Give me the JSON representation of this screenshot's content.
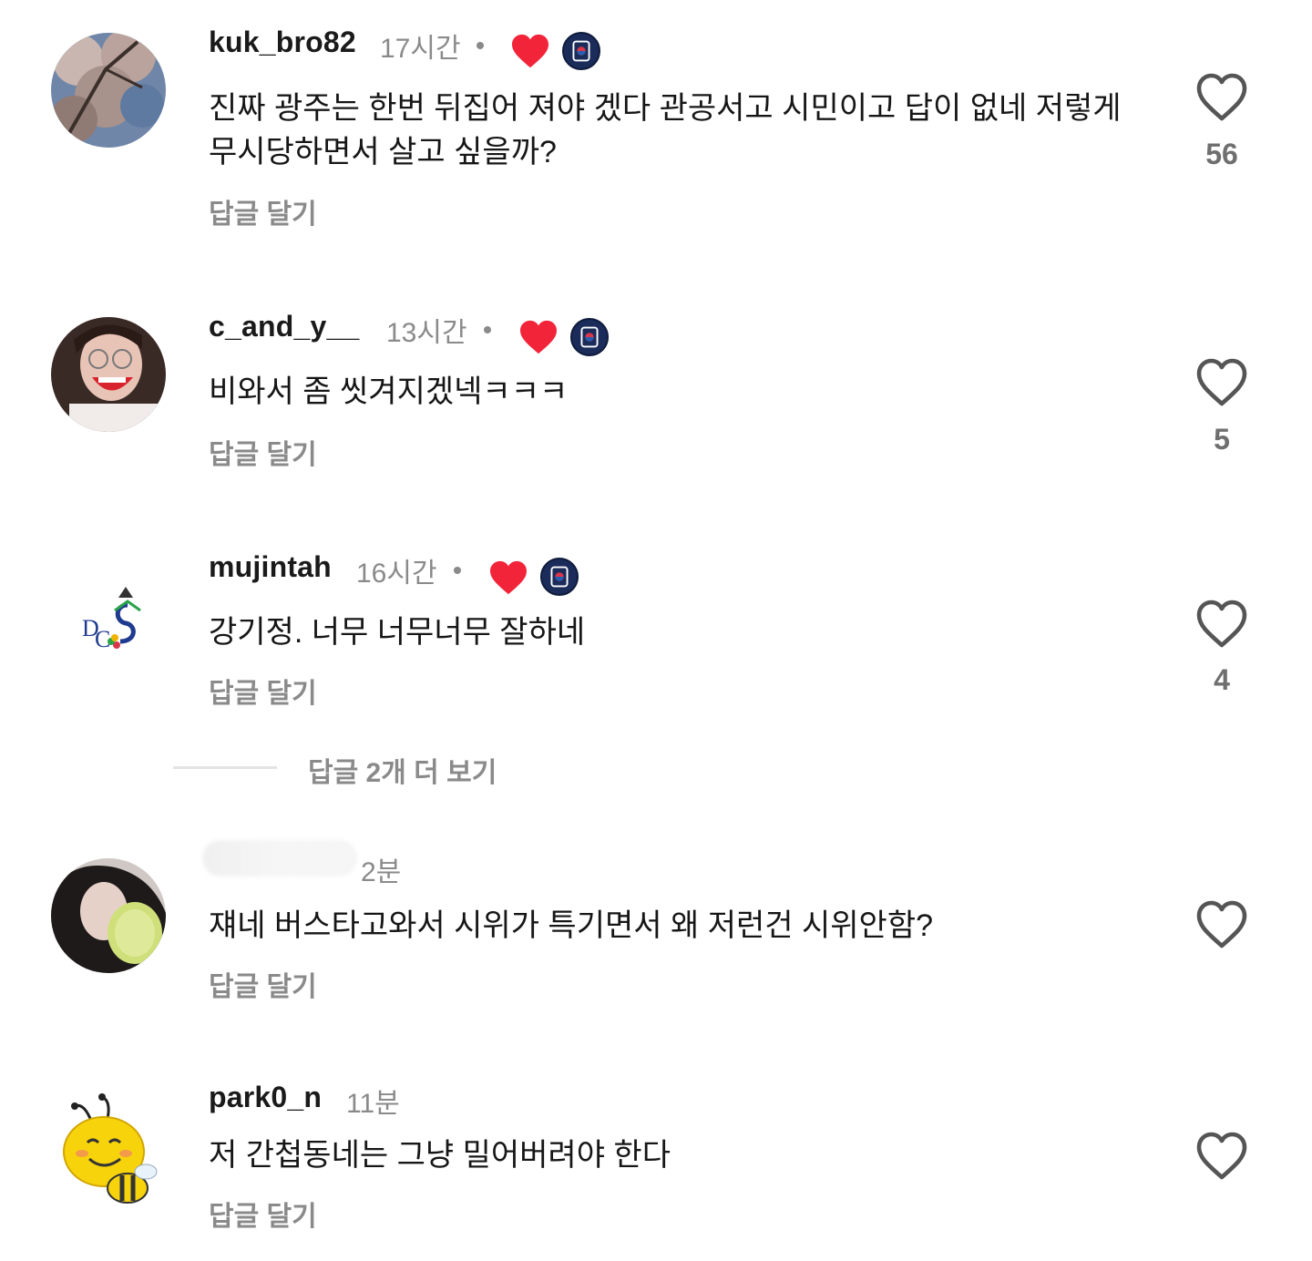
{
  "comments": [
    {
      "username": "kuk_bro82",
      "time": "17시간",
      "text": "진짜 광주는 한번 뒤집어 져야 겠다 관공서고 시민이고 답이 없네 저렇게 무시당하면서 살고 싶을까?",
      "reply_label": "답글 달기",
      "likes": "56",
      "creator_liked": true
    },
    {
      "username": "c_and_y__",
      "time": "13시간",
      "text": "비와서 좀 씻겨지겠넥ㅋㅋㅋ",
      "reply_label": "답글 달기",
      "likes": "5",
      "creator_liked": true
    },
    {
      "username": "mujintah",
      "time": "16시간",
      "text": "강기정. 너무 너무너무 잘하네",
      "reply_label": "답글 달기",
      "likes": "4",
      "creator_liked": true,
      "more_replies": "답글 2개 더 보기"
    },
    {
      "username": "",
      "time": "2분",
      "text": "쟤네 버스타고와서 시위가 특기면서 왜 저런건 시위안함?",
      "reply_label": "답글 달기",
      "likes": "",
      "creator_liked": false
    },
    {
      "username": "park0_n",
      "time": "11분",
      "text": "저 간첩동네는 그냥 밀어버려야 한다",
      "reply_label": "답글 달기",
      "likes": "",
      "creator_liked": false
    }
  ],
  "icons": {
    "like": "heart-outline-icon",
    "creator_like": "heart-filled-icon",
    "badge": "creator-badge-icon"
  },
  "colors": {
    "heart_red": "#f2243a",
    "muted_text": "#8a8a8a",
    "badge_navy": "#1b2c5a"
  }
}
